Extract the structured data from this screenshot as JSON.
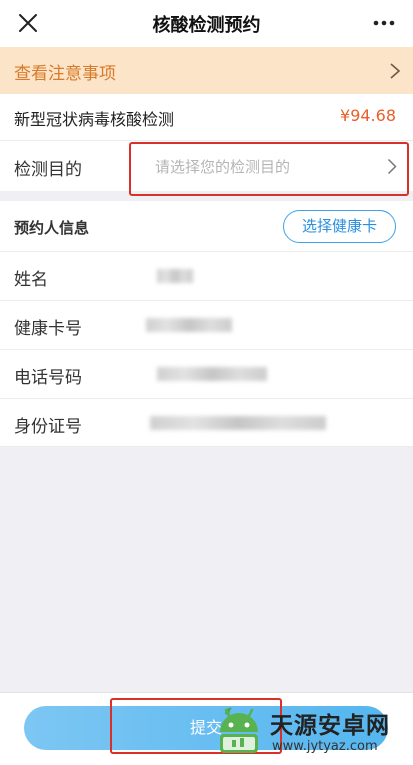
{
  "nav": {
    "title": "核酸检测预约",
    "close_icon": "close-icon",
    "more_icon": "more-icon"
  },
  "notice": {
    "text": "查看注意事项",
    "icon": "chevron-right-icon"
  },
  "item": {
    "name": "新型冠状病毒核酸检测",
    "price": "¥94.68"
  },
  "purpose": {
    "label": "检测目的",
    "placeholder": "请选择您的检测目的",
    "icon": "chevron-right-icon"
  },
  "booker": {
    "title": "预约人信息",
    "select_card_label": "选择健康卡"
  },
  "form": {
    "name_label": "姓名",
    "card_label": "健康卡号",
    "phone_label": "电话号码",
    "id_label": "身份证号"
  },
  "footer": {
    "submit_label": "提交"
  },
  "watermark": {
    "title": "天源安卓网",
    "url": "www.jytyaz.com"
  },
  "colors": {
    "accent": "#2a8fe0",
    "price": "#e8602c",
    "notice_text": "#d97a2a",
    "highlight": "#d9302a"
  }
}
